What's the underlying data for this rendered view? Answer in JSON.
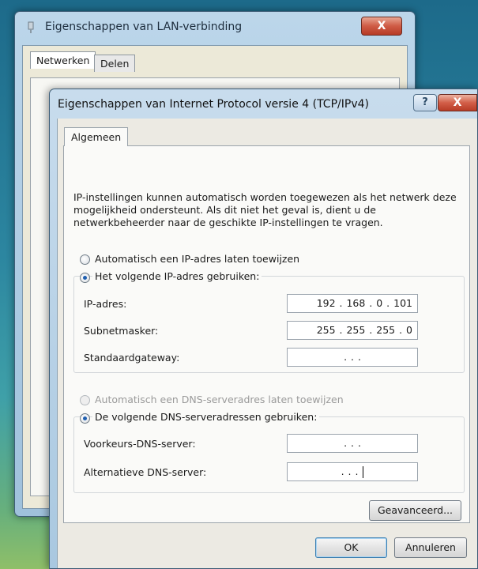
{
  "background_window": {
    "title": "Eigenschappen van LAN-verbinding",
    "close_label": "X",
    "tabs": [
      "Netwerken",
      "Delen"
    ]
  },
  "dialog": {
    "title": "Eigenschappen van Internet Protocol versie 4 (TCP/IPv4)",
    "help_label": "?",
    "close_label": "X",
    "tab": "Algemeen",
    "description": "IP-instellingen kunnen automatisch worden toegewezen als het netwerk deze mogelijkheid ondersteunt. Als dit niet het geval is, dient u de netwerkbeheerder naar de geschikte IP-instellingen te vragen.",
    "ip_auto_label": "Automatisch een IP-adres laten toewijzen",
    "ip_manual_label": "Het volgende IP-adres gebruiken:",
    "ip_selected": "manual",
    "fields": {
      "ip_address": {
        "label": "IP-adres:",
        "value": "192 . 168 .  0  . 101"
      },
      "subnet": {
        "label": "Subnetmasker:",
        "value": "255 . 255 . 255 .  0"
      },
      "gateway": {
        "label": "Standaardgateway:",
        "value": ".        .        ."
      }
    },
    "dns_auto_label": "Automatisch een DNS-serveradres laten toewijzen",
    "dns_manual_label": "De volgende DNS-serveradressen gebruiken:",
    "dns_selected": "manual",
    "dns": {
      "preferred": {
        "label": "Voorkeurs-DNS-server:",
        "value": ".        .        ."
      },
      "alternate": {
        "label": "Alternatieve DNS-server:",
        "value": ".        .        ."
      }
    },
    "advanced_button": "Geavanceerd...",
    "ok_button": "OK",
    "cancel_button": "Annuleren"
  }
}
